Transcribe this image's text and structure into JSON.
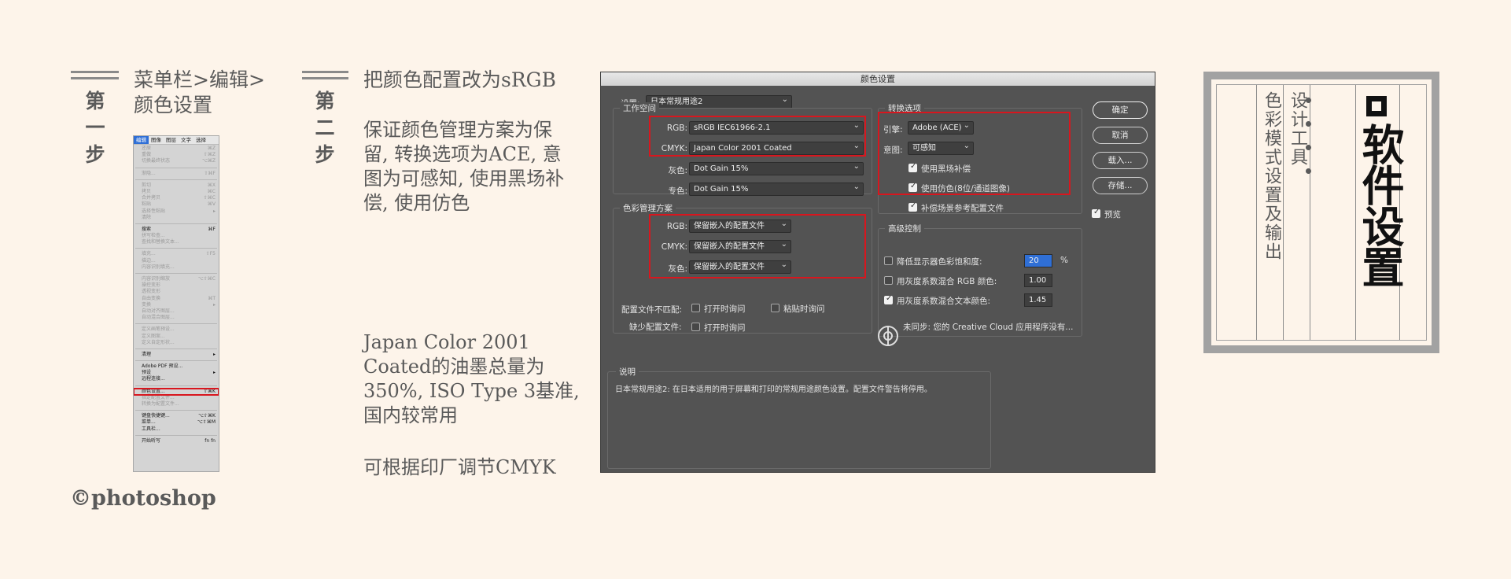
{
  "step1": {
    "label": "第一步",
    "chars": [
      "第",
      "一",
      "步"
    ],
    "text_line1": "菜单栏>编辑>",
    "text_line2": "颜色设置"
  },
  "step2": {
    "label": "第二步",
    "chars": [
      "第",
      "二",
      "步"
    ],
    "para1": "把颜色配置改为sRGB",
    "para2_lines": [
      "保证颜色管理方案为保",
      "留, 转换选项为ACE, 意",
      "图为可感知, 使用黑场补",
      "偿, 使用仿色"
    ],
    "para3_lines": [
      "Japan Color 2001",
      "Coated的油墨总量为",
      "350%, ISO Type 3基准,",
      "国内较常用"
    ],
    "para4": "可根据印厂调节CMYK"
  },
  "footer": {
    "source": "©photoshop"
  },
  "menu": {
    "menubar": [
      "编辑",
      "图像",
      "图层",
      "文字",
      "选择"
    ],
    "items": [
      {
        "label": "还原",
        "shortcut": "⌘Z"
      },
      {
        "label": "重做",
        "shortcut": "⇧⌘Z"
      },
      {
        "label": "切换最终状态",
        "shortcut": "⌥⌘Z"
      },
      {
        "sep": true
      },
      {
        "label": "渐隐...",
        "shortcut": "⇧⌘F"
      },
      {
        "sep": true
      },
      {
        "label": "剪切",
        "shortcut": "⌘X"
      },
      {
        "label": "拷贝",
        "shortcut": "⌘C"
      },
      {
        "label": "合并拷贝",
        "shortcut": "⇧⌘C"
      },
      {
        "label": "粘贴",
        "shortcut": "⌘V"
      },
      {
        "label": "选择性粘贴",
        "shortcut": "▸"
      },
      {
        "label": "清除",
        "shortcut": ""
      },
      {
        "sep": true
      },
      {
        "label": "搜索",
        "shortcut": "⌘F",
        "enabled": true
      },
      {
        "label": "拼写检查...",
        "shortcut": ""
      },
      {
        "label": "查找和替换文本...",
        "shortcut": ""
      },
      {
        "sep": true
      },
      {
        "label": "填充...",
        "shortcut": "⇧F5"
      },
      {
        "label": "描边...",
        "shortcut": ""
      },
      {
        "label": "内容识别填充...",
        "shortcut": ""
      },
      {
        "sep": true
      },
      {
        "label": "内容识别缩放",
        "shortcut": "⌥⇧⌘C"
      },
      {
        "label": "操控变形",
        "shortcut": ""
      },
      {
        "label": "透视变形",
        "shortcut": ""
      },
      {
        "label": "自由变换",
        "shortcut": "⌘T"
      },
      {
        "label": "变换",
        "shortcut": "▸"
      },
      {
        "label": "自动对齐图层...",
        "shortcut": ""
      },
      {
        "label": "自动混合图层...",
        "shortcut": ""
      },
      {
        "sep": true
      },
      {
        "label": "定义画笔预设...",
        "shortcut": ""
      },
      {
        "label": "定义图案...",
        "shortcut": ""
      },
      {
        "label": "定义自定形状...",
        "shortcut": ""
      },
      {
        "sep": true
      },
      {
        "label": "清理",
        "shortcut": "▸",
        "enabled": true
      },
      {
        "sep": true
      },
      {
        "label": "Adobe PDF 预设...",
        "shortcut": "",
        "enabled": true
      },
      {
        "label": "预设",
        "shortcut": "▸",
        "enabled": true
      },
      {
        "label": "远程连接...",
        "shortcut": "",
        "enabled": true
      },
      {
        "sep": true
      },
      {
        "label": "颜色设置...",
        "shortcut": "⇧⌘K",
        "enabled": true,
        "highlight": true
      },
      {
        "label": "指定配置文件...",
        "shortcut": ""
      },
      {
        "label": "转换为配置文件...",
        "shortcut": ""
      },
      {
        "sep": true
      },
      {
        "label": "键盘快捷键...",
        "shortcut": "⌥⇧⌘K",
        "enabled": true
      },
      {
        "label": "菜单...",
        "shortcut": "⌥⇧⌘M",
        "enabled": true
      },
      {
        "label": "工具栏...",
        "shortcut": "",
        "enabled": true
      },
      {
        "sep": true
      },
      {
        "label": "开始听写",
        "shortcut": "fn fn",
        "enabled": true
      }
    ]
  },
  "dialog": {
    "title": "颜色设置",
    "settings_label": "设置:",
    "settings_value": "日本常规用途2",
    "workspace": {
      "legend": "工作空间",
      "rgb_label": "RGB:",
      "rgb_value": "sRGB IEC61966-2.1",
      "cmyk_label": "CMYK:",
      "cmyk_value": "Japan Color 2001 Coated",
      "gray_label": "灰色:",
      "gray_value": "Dot Gain 15%",
      "spot_label": "专色:",
      "spot_value": "Dot Gain 15%"
    },
    "policies": {
      "legend": "色彩管理方案",
      "rgb_label": "RGB:",
      "rgb_value": "保留嵌入的配置文件",
      "cmyk_label": "CMYK:",
      "cmyk_value": "保留嵌入的配置文件",
      "gray_label": "灰色:",
      "gray_value": "保留嵌入的配置文件",
      "mismatch_label": "配置文件不匹配:",
      "ask_open": "打开时询问",
      "ask_paste": "粘贴时询问",
      "missing_label": "缺少配置文件:",
      "ask_open_missing": "打开时询问"
    },
    "conversion": {
      "legend": "转换选项",
      "engine_label": "引擎:",
      "engine_value": "Adobe (ACE)",
      "intent_label": "意图:",
      "intent_value": "可感知",
      "bpc": "使用黑场补偿",
      "dither": "使用仿色(8位/通道图像)",
      "compensate": "补偿场景参考配置文件"
    },
    "advanced": {
      "legend": "高级控制",
      "desaturate": "降低显示器色彩饱和度:",
      "desaturate_value": "20",
      "percent": "%",
      "blend_rgb": "用灰度系数混合 RGB 颜色:",
      "blend_rgb_value": "1.00",
      "blend_text": "用灰度系数混合文本颜色:",
      "blend_text_value": "1.45"
    },
    "sync_status": "未同步: 您的 Creative Cloud 应用程序没有...",
    "description": {
      "legend": "说明",
      "text": "日本常规用途2:  在日本适用的用于屏幕和打印的常规用途颜色设置。配置文件警告将停用。"
    },
    "buttons": {
      "ok": "确定",
      "cancel": "取消",
      "load": "载入...",
      "save": "存储..."
    },
    "preview_label": "预览"
  },
  "card": {
    "title": "软件设置",
    "subtitle": "设计工具",
    "desc": "色彩模式设置及输出"
  }
}
